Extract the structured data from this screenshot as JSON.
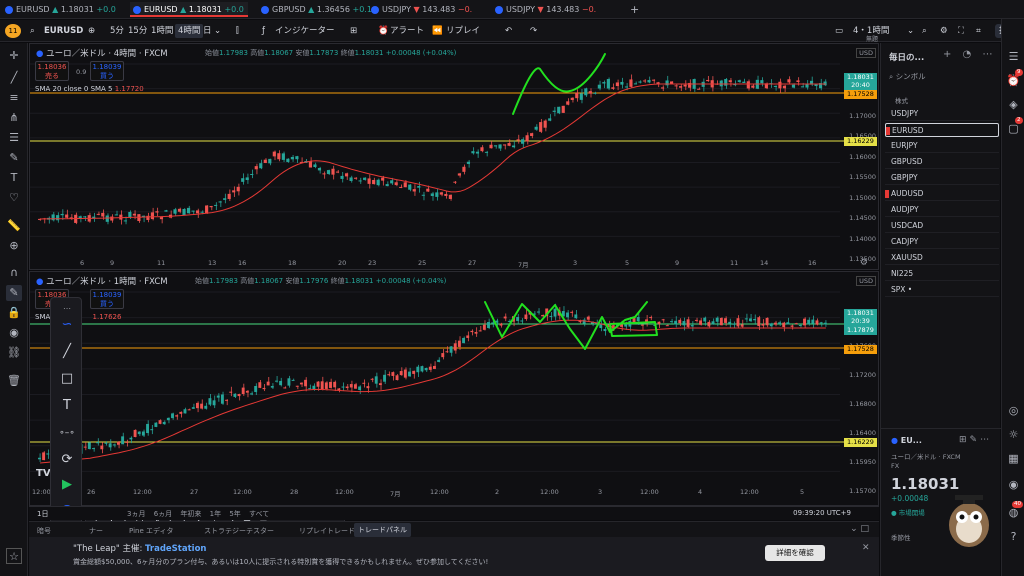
{
  "tabs": [
    {
      "symbol": "EURUSD",
      "dir": "▲",
      "price": "1.18031",
      "change": "+0.0"
    },
    {
      "symbol": "EURUSD",
      "dir": "▲",
      "price": "1.18031",
      "change": "+0.0"
    },
    {
      "symbol": "GBPUSD",
      "dir": "▲",
      "price": "1.36456",
      "change": "+0.1"
    },
    {
      "symbol": "USDJPY",
      "dir": "▼",
      "price": "143.483",
      "change": "−0."
    },
    {
      "symbol": "USDJPY",
      "dir": "▼",
      "price": "143.483",
      "change": "−0."
    }
  ],
  "toolbar": {
    "avatar": "11",
    "symbol": "EURUSD",
    "intervals": [
      "5分",
      "15分",
      "1時間",
      "4時間",
      "日"
    ],
    "indicators": "インジケーター",
    "alert": "アラート",
    "replay": "リプレイ",
    "layout": "4・1時間",
    "layout_sub": "無題",
    "publish": "投稿"
  },
  "top_pane": {
    "title": "ユーロ／米ドル · 4時間 · FXCM",
    "ohlc": {
      "o_label": "始値",
      "o": "1.17983",
      "h_label": "高値",
      "h": "1.18067",
      "l_label": "安値",
      "l": "1.17873",
      "c_label": "終値",
      "c": "1.18031",
      "chg": "+0.00048 (+0.04%)"
    },
    "sell": {
      "price": "1.18036",
      "label": "売る"
    },
    "spread": "0.9",
    "buy": {
      "price": "1.18039",
      "label": "買う"
    },
    "indicator": "SMA 20 close 0 SMA 5",
    "indicator_val": "1.17720",
    "currency": "USD",
    "price_ticks": [
      "1.17500",
      "1.17000",
      "1.16500",
      "1.16000",
      "1.15500",
      "1.15000",
      "1.14500",
      "1.14000",
      "1.13500"
    ],
    "tags": {
      "last": "1.18031",
      "last_time": "20:40",
      "level1": "1.17528",
      "level2": "1.16229"
    },
    "x_labels": [
      "6",
      "9",
      "11",
      "13",
      "16",
      "18",
      "20",
      "23",
      "25",
      "27",
      "7月",
      "3",
      "5",
      "9",
      "11",
      "14",
      "16"
    ]
  },
  "bottom_pane": {
    "title": "ユーロ／米ドル · 1時間 · FXCM",
    "ohlc": {
      "o_label": "始値",
      "o": "1.17983",
      "h_label": "高値",
      "h": "1.18067",
      "l_label": "安値",
      "l": "1.17976",
      "c_label": "終値",
      "c": "1.18031",
      "chg": "+0.00048 (+0.04%)"
    },
    "sell": {
      "price": "1.18036",
      "label": "売る"
    },
    "buy": {
      "price": "1.18039",
      "label": "買う"
    },
    "indicator_prefix": "SMA",
    "indicator_val": "1.17626",
    "currency": "USD",
    "price_ticks": [
      "1.17600",
      "1.17200",
      "1.16800",
      "1.16400",
      "1.15950",
      "1.15700"
    ],
    "tags": {
      "last": "1.18031",
      "last_time": "20:39",
      "sma": "1.17879",
      "level1": "1.17528",
      "level2": "1.16229"
    },
    "x_labels": [
      "12:00",
      "26",
      "12:00",
      "27",
      "12:00",
      "28",
      "12:00",
      "7月",
      "12:00",
      "2",
      "12:00",
      "3",
      "12:00",
      "4",
      "12:00",
      "5"
    ]
  },
  "bottom_bar": {
    "range": "1日",
    "items": [
      "3ヵ月",
      "6ヵ月",
      "年初来",
      "1年",
      "5年",
      "すべて"
    ],
    "clock": "09:39:20 UTC+9"
  },
  "trade_bar": {
    "items": [
      "暗号",
      "ナー",
      "Pine エディタ",
      "ストラテジーテスター",
      "リプレイトレード"
    ],
    "tooltip": "トレードパネル"
  },
  "ad": {
    "title": "\"The Leap\" 主催:",
    "brand": "TradeStation",
    "body": "賞金総額$50,000、6ヶ月分のプラン付与、あるいは10人に提示される特別賞を獲得できるかもしれません。ぜひ参加してください!",
    "cta": "詳細を確認"
  },
  "watchlist": {
    "title": "毎日の...",
    "search": "シンボル",
    "section": "株式",
    "items": [
      {
        "name": "USDJPY",
        "flag": false
      },
      {
        "name": "EURUSD",
        "flag": true,
        "selected": true
      },
      {
        "name": "EURJPY",
        "flag": false
      },
      {
        "name": "GBPUSD",
        "flag": false
      },
      {
        "name": "GBPJPY",
        "flag": false
      },
      {
        "name": "AUDUSD",
        "flag": true
      },
      {
        "name": "AUDJPY",
        "flag": false
      },
      {
        "name": "USDCAD",
        "flag": false
      },
      {
        "name": "CADJPY",
        "flag": false
      },
      {
        "name": "XAUUSD",
        "flag": false
      },
      {
        "name": "NI225",
        "flag": false
      },
      {
        "name": "SPX •",
        "flag": false
      }
    ],
    "detail": {
      "symbol": "EU...",
      "name": "ユーロ／米ドル",
      "source": "FXCM",
      "type": "FX",
      "price": "1.18031",
      "change": "+0.00048",
      "status": "市場開場",
      "seasonal": "季節性"
    }
  },
  "rightbar": {
    "badge1": "9",
    "badge2": "2",
    "badge3": "40"
  }
}
